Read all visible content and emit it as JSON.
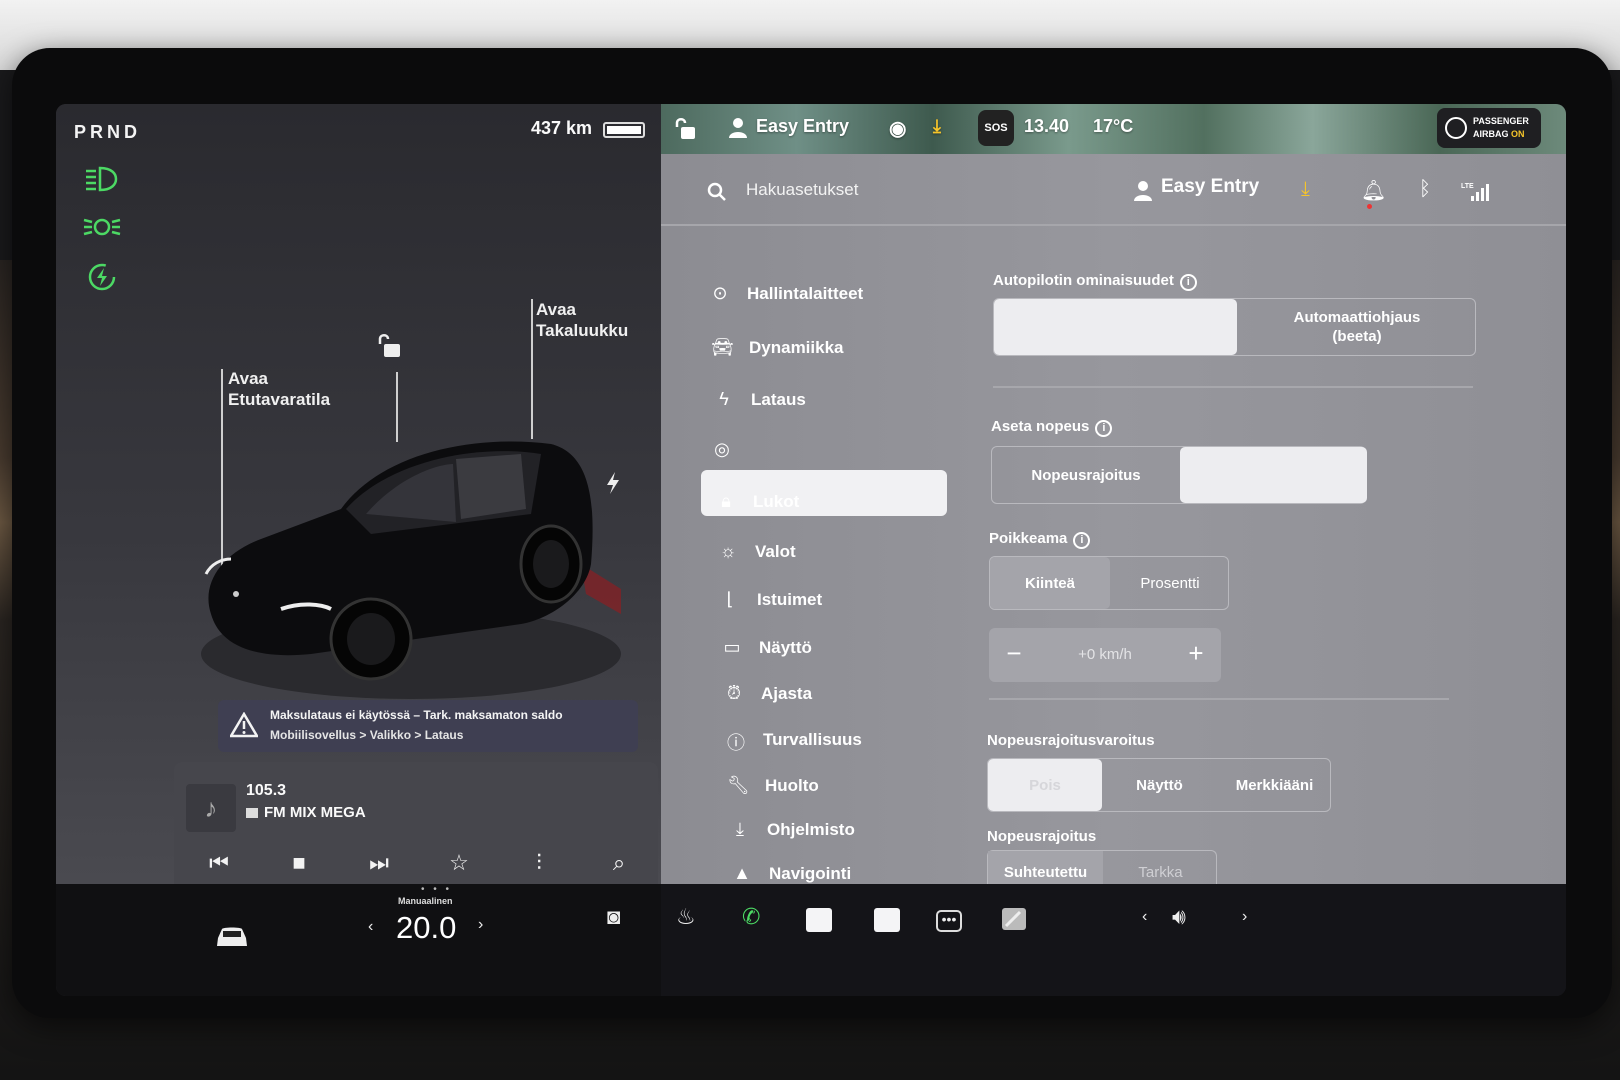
{
  "status": {
    "gear": "PRND",
    "range": "437 km"
  },
  "car_view": {
    "frunk_label_1": "Avaa",
    "frunk_label_2": "Etutavaratila",
    "trunk_label_1": "Avaa",
    "trunk_label_2": "Takaluukku"
  },
  "alert": {
    "line1": "Maksulataus ei käytössä – Tark. maksamaton saldo",
    "line2": "Mobiilisovellus > Valikko > Lataus"
  },
  "media": {
    "frequency": "105.3",
    "station": "FM MIX MEGA"
  },
  "mapbar": {
    "profile": "Easy Entry",
    "sos": "SOS",
    "time": "13.40",
    "temperature": "17°C",
    "airbag_line1": "PASSENGER",
    "airbag_line2": "AIRBAG",
    "airbag_state": "ON"
  },
  "settings": {
    "search_placeholder": "Hakuasetukset",
    "profile": "Easy Entry",
    "nav": [
      {
        "label": "Hallintalaitteet",
        "icon": "toggle-icon"
      },
      {
        "label": "Dynamiikka",
        "icon": "car-icon"
      },
      {
        "label": "Lataus",
        "icon": "bolt-icon"
      },
      {
        "label": "",
        "icon": "steering-icon"
      },
      {
        "label": "Lukot",
        "icon": "lock-icon"
      },
      {
        "label": "Valot",
        "icon": "sun-icon"
      },
      {
        "label": "Istuimet",
        "icon": "seat-icon"
      },
      {
        "label": "Näyttö",
        "icon": "display-icon"
      },
      {
        "label": "Ajasta",
        "icon": "alarm-icon"
      },
      {
        "label": "Turvallisuus",
        "icon": "info-circle-icon"
      },
      {
        "label": "Huolto",
        "icon": "wrench-icon"
      },
      {
        "label": "Ohjelmisto",
        "icon": "download-icon"
      },
      {
        "label": "Navigointi",
        "icon": "navigation-icon"
      }
    ],
    "autopilot_title": "Autopilotin ominaisuudet",
    "autopilot_options": [
      "",
      "Automaattiohjaus\n(beeta)"
    ],
    "set_speed_title": "Aseta nopeus",
    "set_speed_options": [
      "Nopeusrajoitus",
      ""
    ],
    "offset_title": "Poikkeama",
    "offset_options": [
      "Kiinteä",
      "Prosentti"
    ],
    "offset_value": "+0 km/h",
    "warning_title": "Nopeusrajoitusvaroitus",
    "warning_options": [
      "Pois",
      "Näyttö",
      "Merkkiääni"
    ],
    "limit_title": "Nopeusrajoitus",
    "limit_options": [
      "Suhteutettu",
      "Tarkka"
    ]
  },
  "dock": {
    "temp_mode": "Manuaalinen",
    "temp_value": "20.0"
  }
}
